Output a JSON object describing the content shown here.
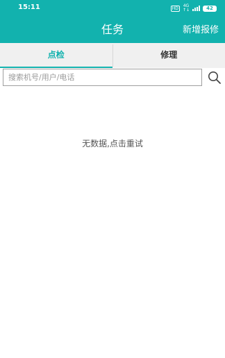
{
  "status_bar": {
    "time": "15:11",
    "hd": "HD",
    "network": "4G",
    "battery": "42",
    "icons": [
      "hd-icon",
      "network-4g-icon",
      "signal-icon",
      "battery-icon"
    ]
  },
  "header": {
    "title": "任务",
    "action_label": "新增报修",
    "background_color": "#12b2ae"
  },
  "tabs": [
    {
      "label": "点检",
      "active": true
    },
    {
      "label": "修理",
      "active": false
    }
  ],
  "search": {
    "placeholder": "搜索机号/用户/电话",
    "value": "",
    "icon": "search-icon"
  },
  "empty_state": {
    "message": "无数据,点击重试"
  }
}
